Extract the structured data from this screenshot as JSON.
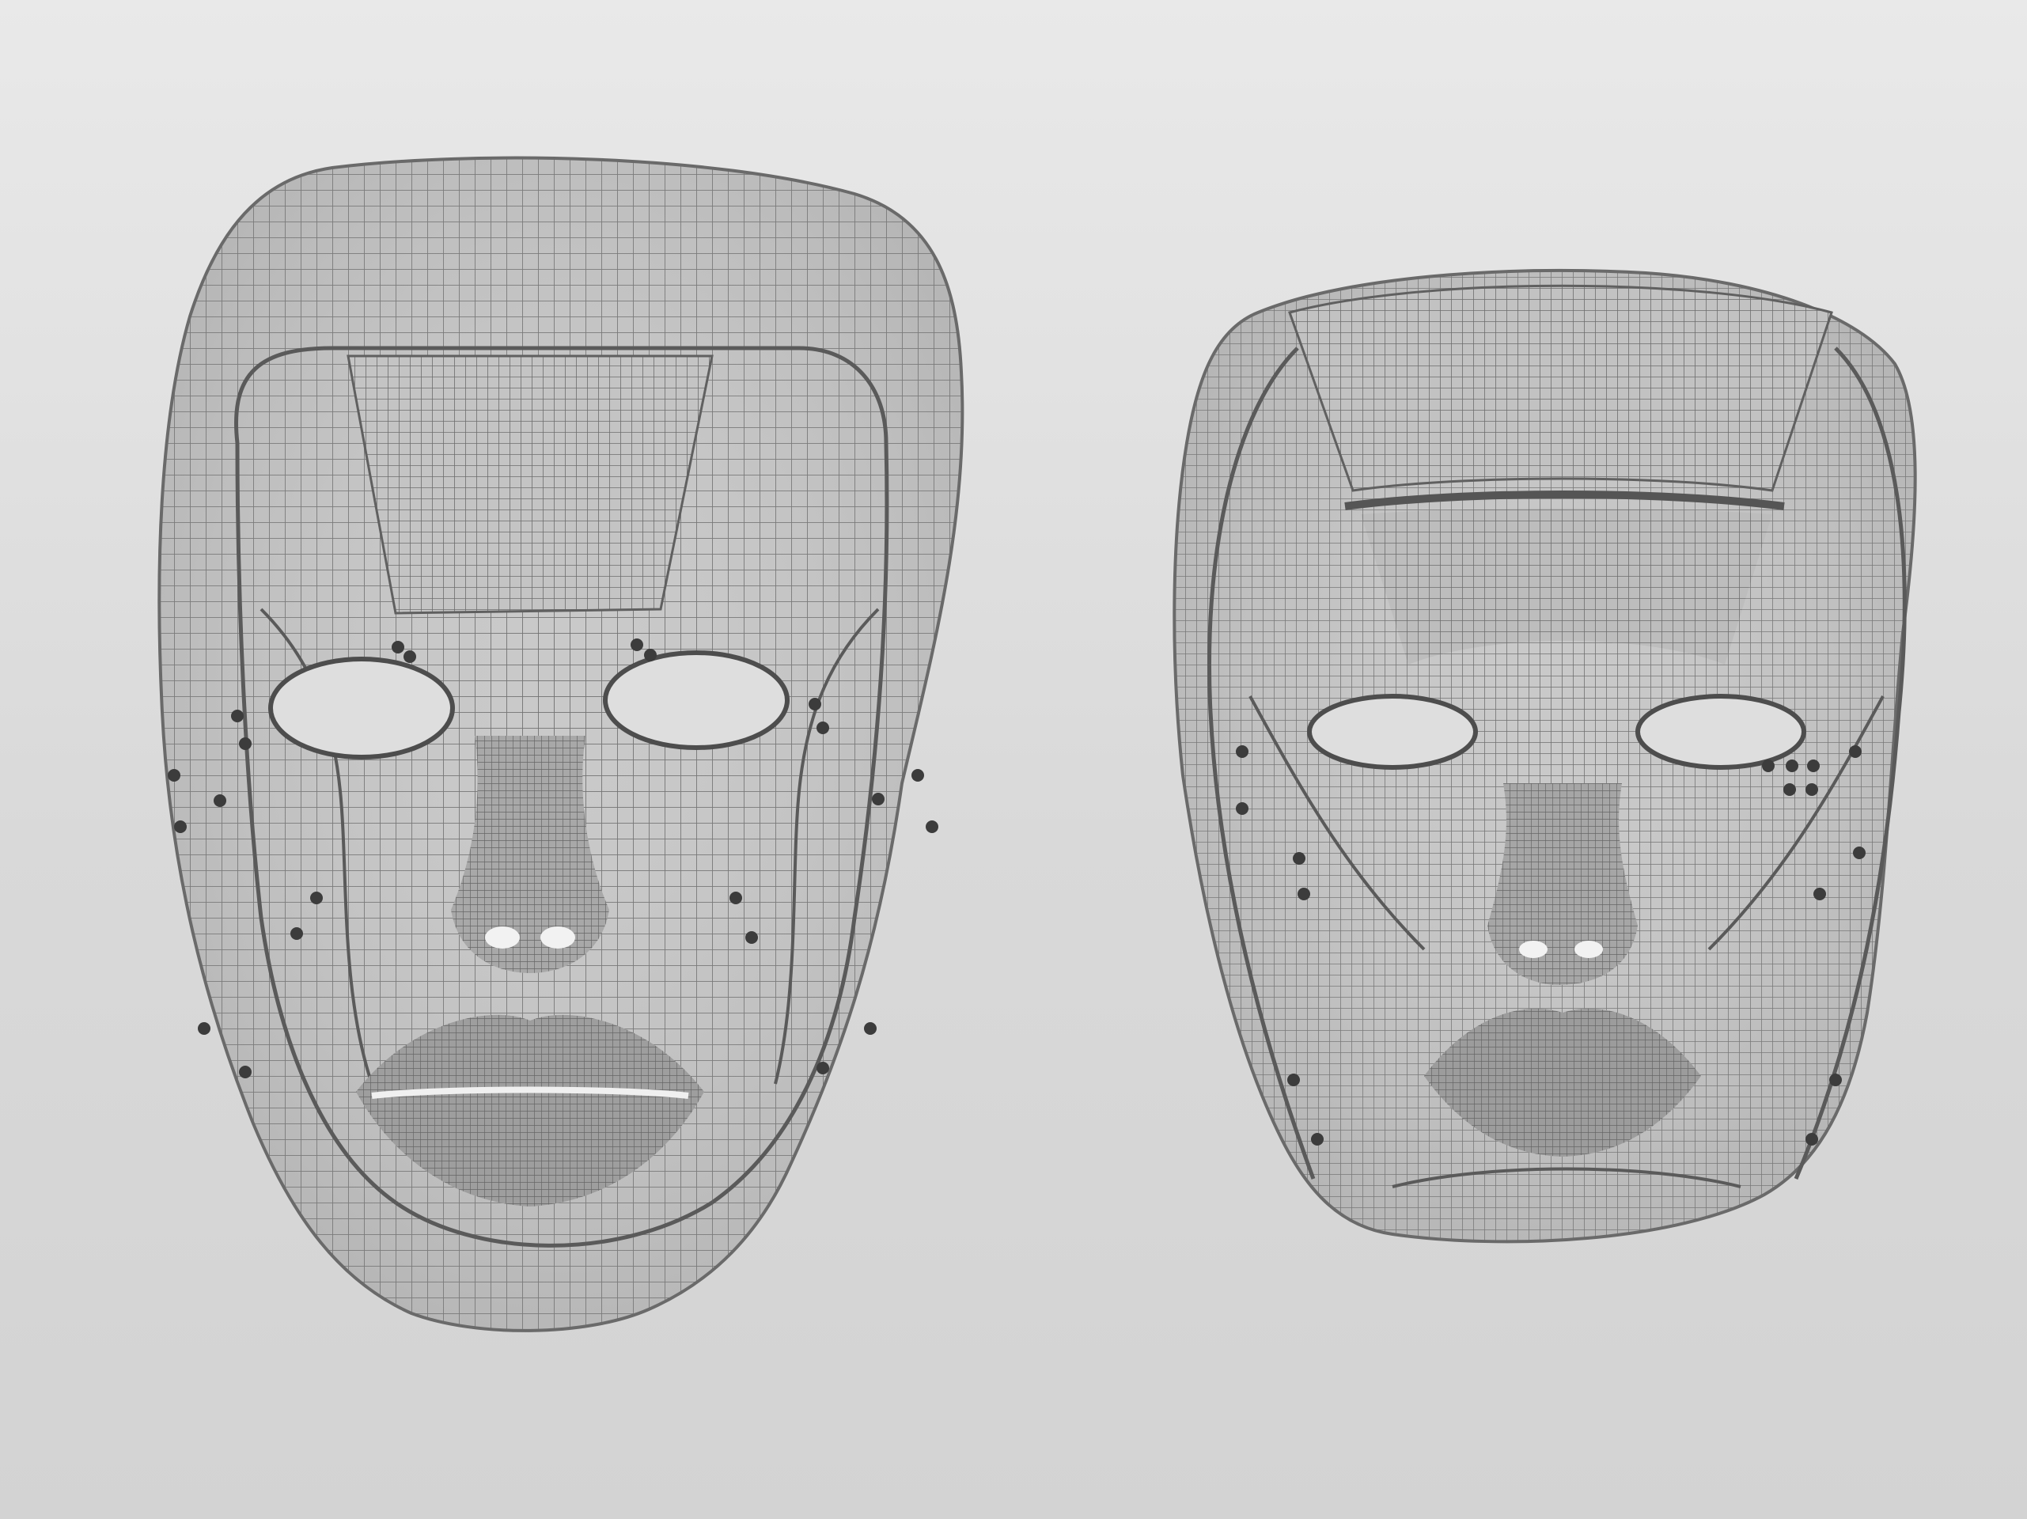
{
  "scene": {
    "description_free": true,
    "colors": {
      "background_top": "#e9e9e9",
      "background_bottom": "#d3d3d3",
      "wire": "#6f6f6f",
      "wire_dark": "#555555",
      "hole": "#3c3c3c"
    },
    "objects": [
      {
        "kind": "wireframe-mask",
        "variant": "oval-long-face"
      },
      {
        "kind": "wireframe-mask",
        "variant": "wide-round-face"
      }
    ]
  }
}
